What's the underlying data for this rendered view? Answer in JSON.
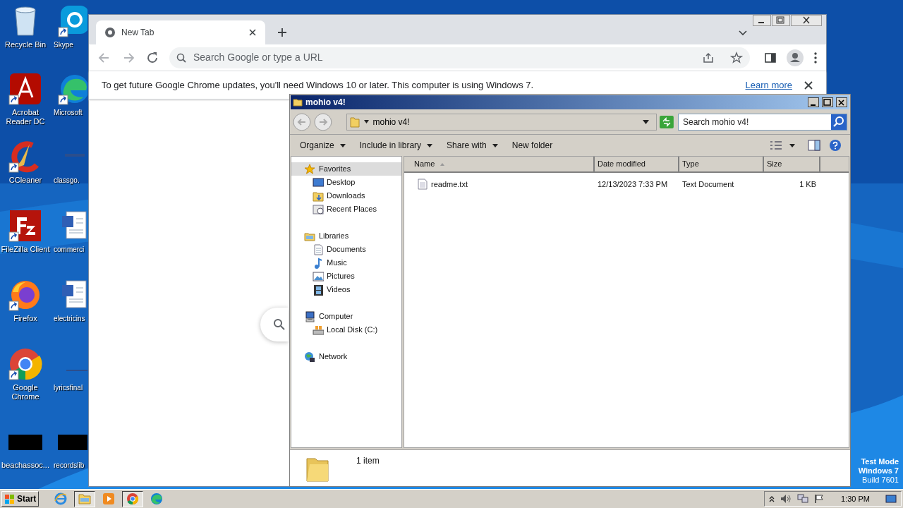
{
  "desktop_icons": [
    {
      "label": "Recycle Bin",
      "shortcut": false
    },
    {
      "label": "Skype",
      "shortcut": true
    },
    {
      "label": "Acrobat Reader DC",
      "shortcut": true
    },
    {
      "label": "Microsoft",
      "shortcut": true
    },
    {
      "label": "CCleaner",
      "shortcut": true
    },
    {
      "label": "classgo.",
      "shortcut": false
    },
    {
      "label": "FileZilla Client",
      "shortcut": true
    },
    {
      "label": "commerci",
      "shortcut": false
    },
    {
      "label": "Firefox",
      "shortcut": true
    },
    {
      "label": "electricins",
      "shortcut": false
    },
    {
      "label": "Google Chrome",
      "shortcut": true
    },
    {
      "label": "lyricsfinal",
      "shortcut": false
    },
    {
      "label": "beachassoc...",
      "shortcut": false
    },
    {
      "label": "recordslib",
      "shortcut": false
    }
  ],
  "browser": {
    "tab": {
      "title": "New Tab"
    },
    "omnibox": {
      "placeholder": "Search Google or type a URL"
    },
    "infobar": {
      "message": "To get future Google Chrome updates, you'll need Windows 10 or later. This computer is using Windows 7.",
      "link": "Learn more"
    }
  },
  "explorer": {
    "title": "mohio v4!",
    "address": "mohio v4!",
    "search": {
      "placeholder": "Search mohio v4!"
    },
    "toolbar": [
      {
        "label": "Organize",
        "dropdown": true
      },
      {
        "label": "Include in library",
        "dropdown": true
      },
      {
        "label": "Share with",
        "dropdown": true
      },
      {
        "label": "New folder",
        "dropdown": false
      }
    ],
    "nav": [
      {
        "label": "Favorites",
        "selected": true,
        "children": [
          {
            "label": "Desktop",
            "selected": false
          },
          {
            "label": "Downloads",
            "selected": false
          },
          {
            "label": "Recent Places",
            "selected": false
          }
        ]
      },
      {
        "label": "Libraries",
        "selected": false,
        "children": [
          {
            "label": "Documents",
            "selected": false
          },
          {
            "label": "Music",
            "selected": false
          },
          {
            "label": "Pictures",
            "selected": false
          },
          {
            "label": "Videos",
            "selected": false
          }
        ]
      },
      {
        "label": "Computer",
        "selected": false,
        "children": [
          {
            "label": "Local Disk (C:)",
            "selected": false
          }
        ]
      },
      {
        "label": "Network",
        "selected": false
      }
    ],
    "columns": [
      {
        "label": "Name",
        "sorted": true
      },
      {
        "label": "Date modified",
        "sorted": false
      },
      {
        "label": "Type",
        "sorted": false
      },
      {
        "label": "Size",
        "sorted": false
      }
    ],
    "rows": [
      {
        "cells": [
          "readme.txt",
          "12/13/2023 7:33 PM",
          "Text Document",
          "1 KB"
        ],
        "selected": false
      }
    ],
    "status": "1 item"
  },
  "taskbar": {
    "start": "Start",
    "tasks": [
      {
        "active": false
      },
      {
        "active": true
      },
      {
        "active": false
      },
      {
        "active": true
      },
      {
        "active": false
      }
    ],
    "clock": "1:30 PM"
  },
  "test_mode": [
    "Test Mode",
    "Windows 7",
    "Build 7601"
  ]
}
